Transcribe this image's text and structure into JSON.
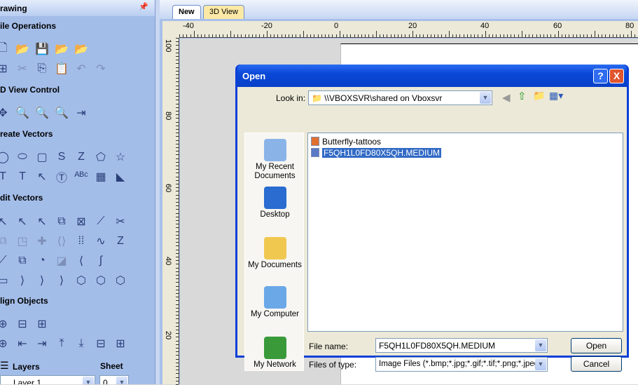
{
  "panel": {
    "title": "rawing",
    "pin_icon": "pin-icon",
    "sections": [
      {
        "label": "ile Operations"
      },
      {
        "label": "D View Control"
      },
      {
        "label": "reate Vectors"
      },
      {
        "label": "dit Vectors"
      },
      {
        "label": "lign Objects"
      }
    ],
    "icon_rows": [
      {
        "section": 0,
        "icons": [
          "new-file-icon",
          "open-folder-icon",
          "save-icon",
          "open-folder-2-icon",
          "import-icon"
        ],
        "glyphs": [
          "🗋",
          "📂",
          "💾",
          "📂",
          "📂"
        ]
      },
      {
        "section": 0,
        "icons": [
          "select-all-icon",
          "cut-icon",
          "copy-icon",
          "paste-icon",
          "undo-icon",
          "redo-icon"
        ],
        "glyphs": [
          "⊞",
          "✂",
          "⎘",
          "📋",
          "↶",
          "↷"
        ],
        "disabled": [
          0,
          1,
          0,
          0,
          1,
          1
        ]
      },
      {
        "section": 1,
        "icons": [
          "pan-icon",
          "zoom-icon",
          "zoom-fit-icon",
          "zoom-box-icon",
          "view-toggle-icon"
        ],
        "glyphs": [
          "✥",
          "🔍",
          "🔍",
          "🔍",
          "⇥"
        ]
      },
      {
        "section": 2,
        "icons": [
          "circle-icon",
          "ellipse-icon",
          "rectangle-icon",
          "spline-icon",
          "polyline-icon",
          "polygon-icon",
          "star-icon"
        ],
        "glyphs": [
          "◯",
          "⬭",
          "▢",
          "S",
          "Z",
          "⬠",
          "☆"
        ]
      },
      {
        "section": 2,
        "icons": [
          "text-icon",
          "text-box-icon",
          "text-select-icon",
          "text-fit-icon",
          "text-arc-icon",
          "table-icon",
          "bitmap-trace-icon"
        ],
        "glyphs": [
          "T",
          "T",
          "↖",
          "Ⓣ",
          "ᴬᴮᶜ",
          "▦",
          "◣"
        ]
      },
      {
        "section": 3,
        "icons": [
          "select-icon",
          "node-edit-icon",
          "transform-icon",
          "group-icon",
          "ungroup-icon",
          "measure-icon",
          "scissors-icon"
        ],
        "glyphs": [
          "↖",
          "↖",
          "↖",
          "⧉",
          "⊠",
          "⟋",
          "✂"
        ]
      },
      {
        "section": 3,
        "icons": [
          "offset-icon",
          "scale-icon",
          "weld-icon",
          "mirror-icon",
          "array-icon",
          "join-icon",
          "zigzag-icon"
        ],
        "glyphs": [
          "⧉",
          "◳",
          "✚",
          "⟨⟩",
          "⁞⁞",
          "∿",
          "Z"
        ],
        "disabled": [
          1,
          1,
          1,
          1,
          0,
          0,
          0
        ]
      },
      {
        "section": 3,
        "icons": [
          "trim-icon",
          "boolean-union-icon",
          "boolean-subtract-icon",
          "boolean-intersect-icon",
          "fillet-icon",
          "smooth-icon"
        ],
        "glyphs": [
          "⟋",
          "⧉",
          "◔",
          "◪",
          "⟨",
          "∫"
        ],
        "disabled": [
          0,
          0,
          0,
          1,
          0,
          0
        ]
      },
      {
        "section": 3,
        "icons": [
          "closed-shape-icon",
          "corner-node-icon",
          "curve-node-icon",
          "add-node-icon",
          "close-vector-icon",
          "close-curve-icon",
          "close-node-icon"
        ],
        "glyphs": [
          "▭",
          "⟩",
          "⟩",
          "⟩",
          "⬡",
          "⬡",
          "⬡"
        ]
      },
      {
        "section": 4,
        "icons": [
          "center-page-icon",
          "center-horizontal-icon",
          "center-vertical-icon"
        ],
        "glyphs": [
          "⊕",
          "⊟",
          "⊞"
        ]
      },
      {
        "section": 4,
        "icons": [
          "align-center-icon",
          "align-left-icon",
          "align-right-icon",
          "align-top-icon",
          "align-bottom-icon",
          "align-h-center-icon",
          "align-v-center-icon"
        ],
        "glyphs": [
          "⊕",
          "⇤",
          "⇥",
          "⤒",
          "⤓",
          "⊟",
          "⊞"
        ]
      }
    ],
    "layers_label": "Layers",
    "sheet_label": "Sheet",
    "layer_value": "Layer 1",
    "sheet_value": "0"
  },
  "tabs": [
    {
      "label": "New",
      "active": true
    },
    {
      "label": "3D View",
      "active": false
    }
  ],
  "ruler": {
    "h_labels": [
      "-40",
      "-20",
      "0",
      "20",
      "40",
      "60",
      "80"
    ],
    "v_labels": [
      "100",
      "80",
      "60",
      "40",
      "20"
    ]
  },
  "dialog": {
    "title": "Open",
    "help_label": "?",
    "close_label": "X",
    "look_in_label": "Look in:",
    "look_in_value": "\\\\VBOXSVR\\shared on Vboxsvr",
    "places": [
      "My Recent Documents",
      "Desktop",
      "My Documents",
      "My Computer",
      "My Network"
    ],
    "files": [
      {
        "name": "Butterfly-tattoos",
        "selected": false
      },
      {
        "name": "F5QH1L0FD80X5QH.MEDIUM",
        "selected": true
      }
    ],
    "file_name_label": "File name:",
    "file_name_value": "F5QH1L0FD80X5QH.MEDIUM",
    "file_type_label": "Files of type:",
    "file_type_value": "Image Files (*.bmp;*.jpg;*.gif;*.tif;*.png;*.jpeg)",
    "open_label": "Open",
    "cancel_label": "Cancel"
  },
  "colors": {
    "panel": "#a3bde9",
    "title_bar": "#0a48d8",
    "selection": "#316ac5",
    "dialog_bg": "#ece9d8"
  }
}
